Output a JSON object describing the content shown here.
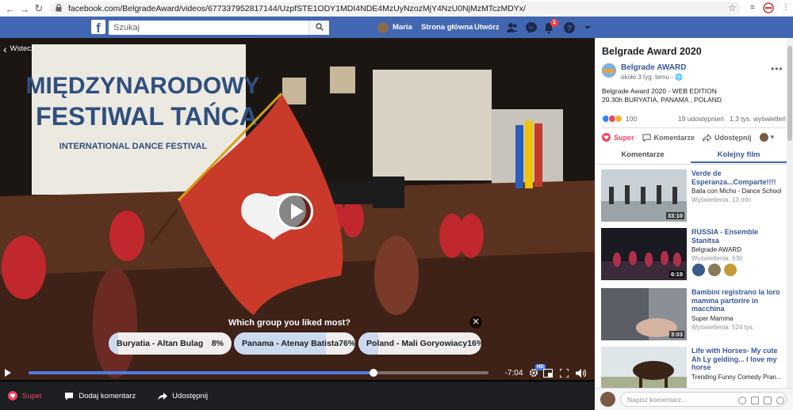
{
  "browser": {
    "url": "facebook.com/BelgradeAward/videos/677337952817144/UzpfSTE1ODY1MDI4NDE4MzUyNzozMjY4NzU0NjMzMTczMDYx/"
  },
  "fb_header": {
    "logo": "f",
    "search_placeholder": "Szukaj",
    "user_name": "Maria",
    "home_label": "Strona główna",
    "create_label": "Utwórz",
    "notification_count": "1"
  },
  "player": {
    "back_label": "Wstecz",
    "poll_question": "Which group you liked most?",
    "poll_close": "✕",
    "options": [
      {
        "label": "Buryatia - Altan Bulag",
        "pct": "8%",
        "share": 0.08
      },
      {
        "label": "Panama - Atenay Batista",
        "pct": "76%",
        "share": 0.76
      },
      {
        "label": "Poland - Mali Goryowiacy",
        "pct": "16%",
        "share": 0.16
      }
    ],
    "progress_fraction": 0.75,
    "time_remaining": "-7:04",
    "hd_badge": "HD",
    "actions": {
      "like": "Super",
      "comment": "Dodaj komentarz",
      "share": "Udostępnij"
    }
  },
  "sidebar": {
    "title": "Belgrade Award 2020",
    "page_name": "Belgrade AWARD",
    "posted": "około 3 tyg. temu · ",
    "description": "Belgrade Award 2020 - WEB EDITION\n20.30h BURYATIA, PANAMA , POLAND",
    "reactions_count": "100",
    "shares": "19 udostępnień",
    "views": "1,3 tys. wyświetleń",
    "buttons": {
      "like": "Super",
      "comment": "Komentarze",
      "share": "Udostępnij"
    },
    "tabs": [
      "Komentarze",
      "Kolejny film"
    ],
    "videos": [
      {
        "title": "Verde de Esperanza...Comparte!!!!",
        "channel": "Baila con Micho - Dance School",
        "views": "Wyświetlenia: 13 mln",
        "duration": "33:10"
      },
      {
        "title": "RUSSIA - Ensemble Stanitsa",
        "channel": "Belgrade AWARD",
        "views": "Wyświetlenia: 630",
        "duration": "6:19"
      },
      {
        "title": "Bambini registrano la loro mamma partorire in macchina",
        "channel": "Super Mamma",
        "views": "Wyświetlenia: 524 tys.",
        "duration": "3:03"
      },
      {
        "title": "Life with Horses- My cute Ah Ly gelding... I love my horse",
        "channel": "Trending Funny Comedy Pran...",
        "views": "",
        "duration": ""
      }
    ],
    "comment_placeholder": "Napisz komentarz..."
  },
  "scene_text": {
    "banner_line1": "MIĘDZYNARODOWY",
    "banner_line2": "FESTIWAL TAŃCA",
    "banner_line3": "INTERNATIONAL DANCE FESTIVAL"
  },
  "colors": {
    "fb_blue": "#4267b2",
    "link_blue": "#385898",
    "progress_blue": "#4b7be5",
    "super_red": "#f3425f"
  }
}
